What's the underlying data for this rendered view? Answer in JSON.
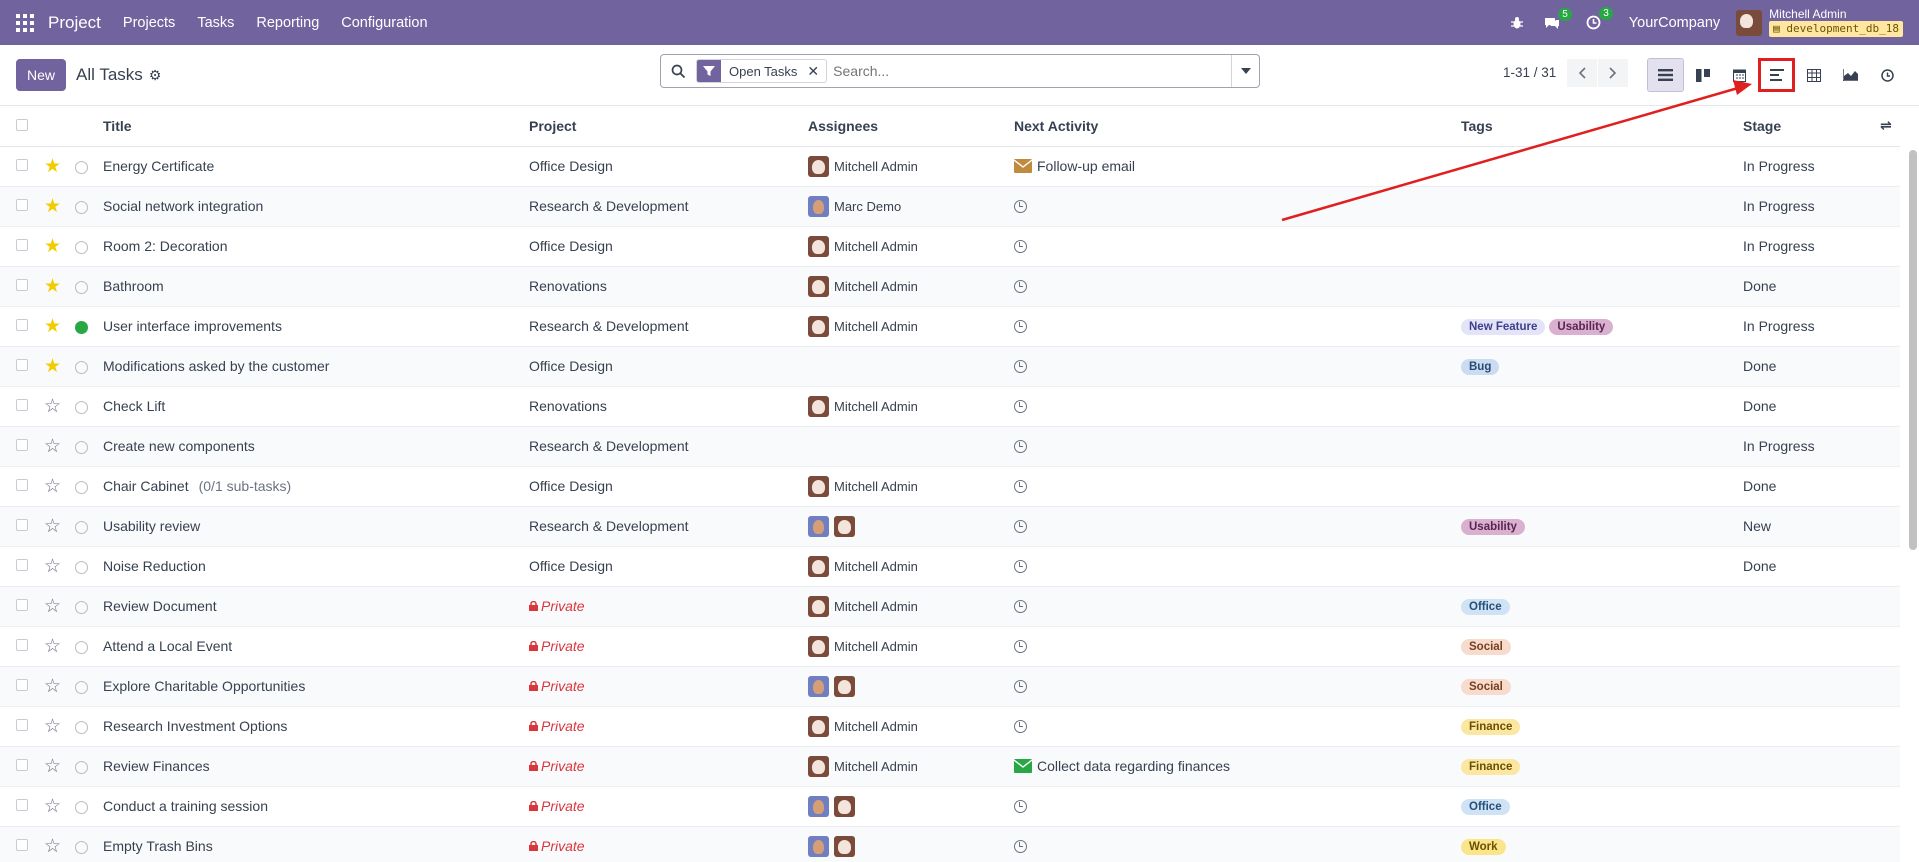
{
  "navbar": {
    "brand": "Project",
    "menus": [
      "Projects",
      "Tasks",
      "Reporting",
      "Configuration"
    ],
    "messages_count": "5",
    "activities_count": "3",
    "company": "YourCompany",
    "user_name": "Mitchell Admin",
    "database": "development_db_18"
  },
  "control": {
    "new_label": "New",
    "breadcrumb": "All Tasks",
    "facet_label": "Open Tasks",
    "search_placeholder": "Search...",
    "pager": "1-31 / 31"
  },
  "views": [
    "list-view-icon",
    "kanban-view-icon",
    "calendar-view-icon",
    "gantt-view-icon",
    "pivot-view-icon",
    "graph-view-icon",
    "activity-view-icon"
  ],
  "table": {
    "headers": [
      "Title",
      "Project",
      "Assignees",
      "Next Activity",
      "Tags",
      "Stage"
    ],
    "rows": [
      {
        "starred": true,
        "state": "normal",
        "title": "Energy Certificate",
        "sub": "",
        "project": "Office Design",
        "private": false,
        "assignees": "Mitchell Admin",
        "av": [
          "m"
        ],
        "activity": "Follow-up email",
        "act_icon": "mail-orange",
        "tags": [],
        "stage": "In Progress"
      },
      {
        "starred": true,
        "state": "normal",
        "title": "Social network integration",
        "sub": "",
        "project": "Research & Development",
        "private": false,
        "assignees": "Marc Demo",
        "av": [
          "d"
        ],
        "activity": "",
        "act_icon": "clock",
        "tags": [],
        "stage": "In Progress"
      },
      {
        "starred": true,
        "state": "normal",
        "title": "Room 2: Decoration",
        "sub": "",
        "project": "Office Design",
        "private": false,
        "assignees": "Mitchell Admin",
        "av": [
          "m"
        ],
        "activity": "",
        "act_icon": "clock",
        "tags": [],
        "stage": "In Progress"
      },
      {
        "starred": true,
        "state": "normal",
        "title": "Bathroom",
        "sub": "",
        "project": "Renovations",
        "private": false,
        "assignees": "Mitchell Admin",
        "av": [
          "m"
        ],
        "activity": "",
        "act_icon": "clock",
        "tags": [],
        "stage": "Done"
      },
      {
        "starred": true,
        "state": "done",
        "title": "User interface improvements",
        "sub": "",
        "project": "Research & Development",
        "private": false,
        "assignees": "Mitchell Admin",
        "av": [
          "m"
        ],
        "activity": "",
        "act_icon": "clock",
        "tags": [
          "New Feature",
          "Usability"
        ],
        "stage": "In Progress"
      },
      {
        "starred": true,
        "state": "normal",
        "title": "Modifications asked by the customer",
        "sub": "",
        "project": "Office Design",
        "private": false,
        "assignees": "",
        "av": [],
        "activity": "",
        "act_icon": "clock",
        "tags": [
          "Bug"
        ],
        "stage": "Done"
      },
      {
        "starred": false,
        "state": "normal",
        "title": "Check Lift",
        "sub": "",
        "project": "Renovations",
        "private": false,
        "assignees": "Mitchell Admin",
        "av": [
          "m"
        ],
        "activity": "",
        "act_icon": "clock",
        "tags": [],
        "stage": "Done"
      },
      {
        "starred": false,
        "state": "normal",
        "title": "Create new components",
        "sub": "",
        "project": "Research & Development",
        "private": false,
        "assignees": "",
        "av": [],
        "activity": "",
        "act_icon": "clock",
        "tags": [],
        "stage": "In Progress"
      },
      {
        "starred": false,
        "state": "normal",
        "title": "Chair Cabinet",
        "sub": "(0/1 sub-tasks)",
        "project": "Office Design",
        "private": false,
        "assignees": "Mitchell Admin",
        "av": [
          "m"
        ],
        "activity": "",
        "act_icon": "clock",
        "tags": [],
        "stage": "Done"
      },
      {
        "starred": false,
        "state": "normal",
        "title": "Usability review",
        "sub": "",
        "project": "Research & Development",
        "private": false,
        "assignees": "",
        "av": [
          "d",
          "m"
        ],
        "activity": "",
        "act_icon": "clock",
        "tags": [
          "Usability"
        ],
        "stage": "New"
      },
      {
        "starred": false,
        "state": "normal",
        "title": "Noise Reduction",
        "sub": "",
        "project": "Office Design",
        "private": false,
        "assignees": "Mitchell Admin",
        "av": [
          "m"
        ],
        "activity": "",
        "act_icon": "clock",
        "tags": [],
        "stage": "Done"
      },
      {
        "starred": false,
        "state": "normal",
        "title": "Review Document",
        "sub": "",
        "project": "Private",
        "private": true,
        "assignees": "Mitchell Admin",
        "av": [
          "m"
        ],
        "activity": "",
        "act_icon": "clock",
        "tags": [
          "Office"
        ],
        "stage": ""
      },
      {
        "starred": false,
        "state": "normal",
        "title": "Attend a Local Event",
        "sub": "",
        "project": "Private",
        "private": true,
        "assignees": "Mitchell Admin",
        "av": [
          "m"
        ],
        "activity": "",
        "act_icon": "clock",
        "tags": [
          "Social"
        ],
        "stage": ""
      },
      {
        "starred": false,
        "state": "normal",
        "title": "Explore Charitable Opportunities",
        "sub": "",
        "project": "Private",
        "private": true,
        "assignees": "",
        "av": [
          "d",
          "m"
        ],
        "activity": "",
        "act_icon": "clock",
        "tags": [
          "Social"
        ],
        "stage": ""
      },
      {
        "starred": false,
        "state": "normal",
        "title": "Research Investment Options",
        "sub": "",
        "project": "Private",
        "private": true,
        "assignees": "Mitchell Admin",
        "av": [
          "m"
        ],
        "activity": "",
        "act_icon": "clock",
        "tags": [
          "Finance"
        ],
        "stage": ""
      },
      {
        "starred": false,
        "state": "normal",
        "title": "Review Finances",
        "sub": "",
        "project": "Private",
        "private": true,
        "assignees": "Mitchell Admin",
        "av": [
          "m"
        ],
        "activity": "Collect data regarding finances",
        "act_icon": "mail-green",
        "tags": [
          "Finance"
        ],
        "stage": ""
      },
      {
        "starred": false,
        "state": "normal",
        "title": "Conduct a training session",
        "sub": "",
        "project": "Private",
        "private": true,
        "assignees": "",
        "av": [
          "d",
          "m"
        ],
        "activity": "",
        "act_icon": "clock",
        "tags": [
          "Office"
        ],
        "stage": ""
      },
      {
        "starred": false,
        "state": "normal",
        "title": "Empty Trash Bins",
        "sub": "",
        "project": "Private",
        "private": true,
        "assignees": "",
        "av": [
          "d",
          "m"
        ],
        "activity": "",
        "act_icon": "clock",
        "tags": [
          "Work"
        ],
        "stage": ""
      }
    ]
  },
  "tag_colors": {
    "New Feature": {
      "bg": "#e4e4f8",
      "fg": "#3e3e8a"
    },
    "Usability": {
      "bg": "#d9b0cf",
      "fg": "#5a2450"
    },
    "Bug": {
      "bg": "#c9dcf2",
      "fg": "#2a4a70"
    },
    "Office": {
      "bg": "#cfe3f5",
      "fg": "#24507a"
    },
    "Social": {
      "bg": "#f7dccd",
      "fg": "#7a3d1e"
    },
    "Finance": {
      "bg": "#fbe7a1",
      "fg": "#6b5000"
    },
    "Work": {
      "bg": "#fbe58a",
      "fg": "#6b5000"
    }
  },
  "colors": {
    "brand": "#71639e",
    "highlight": "#e02020",
    "star": "#f3cc00",
    "private": "#d9363e"
  }
}
